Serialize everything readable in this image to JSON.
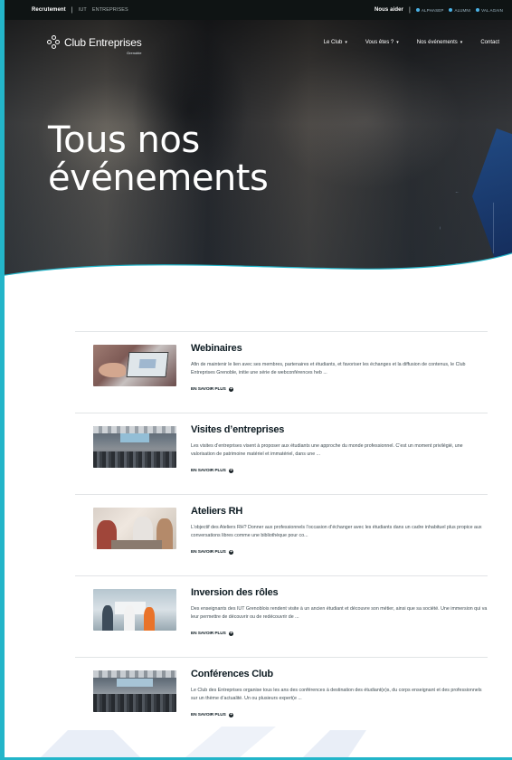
{
  "topbar": {
    "recrutement": "Recrutement",
    "iut": "IUT",
    "entreprises": "ENTREPRISES",
    "nous_aider": "Nous aider",
    "links": [
      "ALPHASEP",
      "ALUMNI",
      "VAL AGAIN"
    ]
  },
  "nav": {
    "logo_text": "Club Entreprises",
    "logo_sub": "Grenoble",
    "menu": [
      {
        "label": "Le Club",
        "caret": true
      },
      {
        "label": "Vous êtes ?",
        "caret": true
      },
      {
        "label": "Nos événements",
        "caret": true
      },
      {
        "label": "Contact",
        "caret": false
      }
    ]
  },
  "hero": {
    "title_line1": "Tous nos",
    "title_line2": "événements"
  },
  "events": [
    {
      "title": "Webinaires",
      "description": "Afin de maintenir le lien avec ses membres, partenaires et étudiants, et favoriser les échanges et la diffusion de contenus, le Club Entreprises Grenoble, initie une série de webconférences heb ...",
      "more": "EN SAVOIR PLUS"
    },
    {
      "title": "Visites d’entreprises",
      "description": "Les visites d’entreprises visent à proposer aux étudiants une approche du monde professionnel. C’est un moment privilégié, une valorisation de patrimoine matériel et immatériel, dans une ...",
      "more": "EN SAVOIR PLUS"
    },
    {
      "title": "Ateliers RH",
      "description": "L’objectif des Ateliers RH? Donner aux professionnels l’occasion d’échanger avec les étudiants dans un cadre inhabituel plus propice aux conversations libres comme une bibliothèque pour co...",
      "more": "EN SAVOIR PLUS"
    },
    {
      "title": "Inversion des rôles",
      "description": "Des enseignants des IUT Grenoblois rendent visite à un ancien étudiant et découvre son métier, ainsi que sa société. Une immersion qui va leur permettre de découvrir ou de redécouvrir de ...",
      "more": "EN SAVOIR PLUS"
    },
    {
      "title": "Conférences Club",
      "description": "Le Club des Entreprises organise tous les ans des conférences à destination des étudiant(e)s, du corps enseignant et des professionnels sur un thème d’actualité. Un ou plusieurs expert(e ...",
      "more": "EN SAVOIR PLUS"
    }
  ],
  "colors": {
    "accent": "#23b5c9",
    "topbar_bg": "#0f1414",
    "title_text": "#0d1b22",
    "body_text": "#3f4c52",
    "hero_blue": "#1f4d8c"
  },
  "icons": [
    "plus-circle-icon",
    "chevron-down-icon",
    "logo-mark-icon"
  ]
}
